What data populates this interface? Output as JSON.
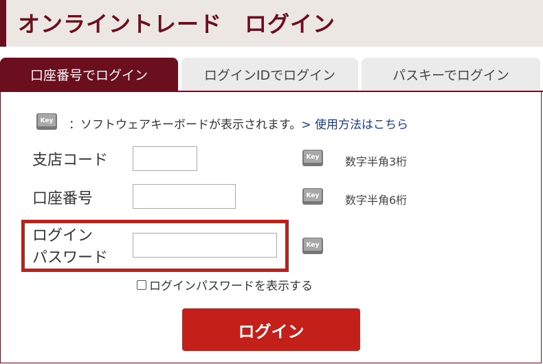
{
  "header": {
    "title": "オンライントレード　ログイン"
  },
  "tabs": [
    {
      "label": "口座番号でログイン",
      "active": true
    },
    {
      "label": "ログインIDでログイン",
      "active": false
    },
    {
      "label": "パスキーでログイン",
      "active": false
    }
  ],
  "keyboard_note": {
    "text": "：ソフトウェアキーボードが表示されます。",
    "link": "> 使用方法はこちら"
  },
  "form": {
    "branch_code": {
      "label": "支店コード",
      "hint": "数字半角3桁",
      "value": ""
    },
    "account_number": {
      "label": "口座番号",
      "hint": "数字半角6桁",
      "value": ""
    },
    "password": {
      "label_line1": "ログイン",
      "label_line2": "パスワード",
      "value": ""
    },
    "show_password": "ログインパスワードを表示する"
  },
  "login_button": "ログイン",
  "colors": {
    "brand": "#6b0f1f",
    "button": "#c4201a",
    "highlight": "#c0201a",
    "link": "#1b3a8a"
  }
}
